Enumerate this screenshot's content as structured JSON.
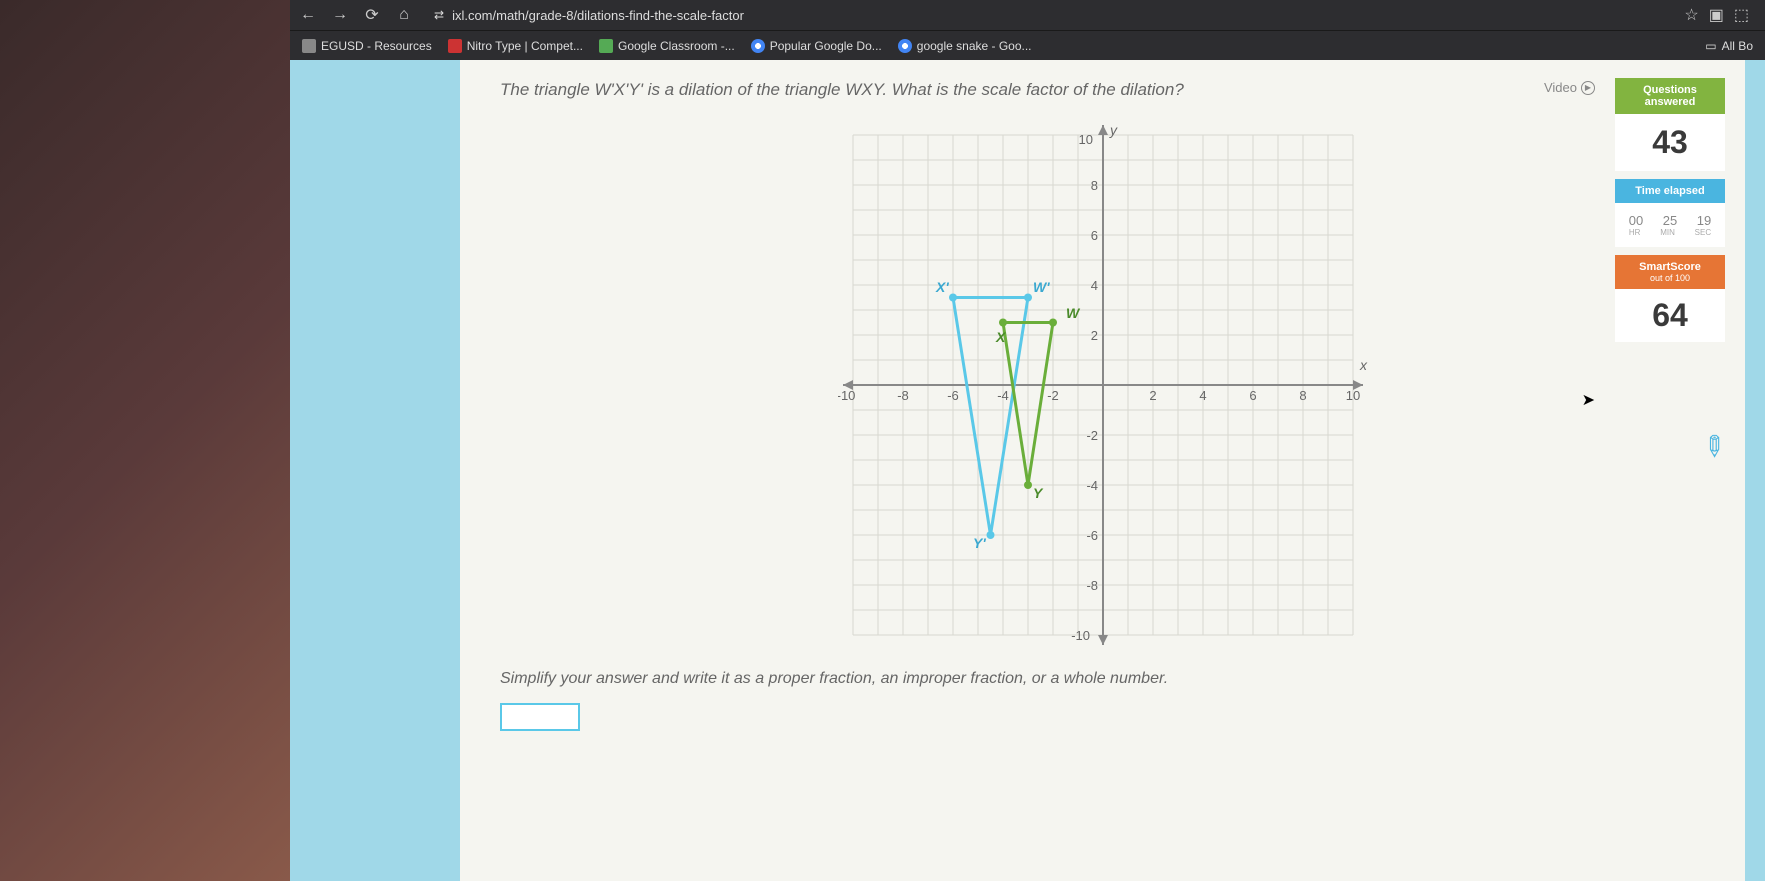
{
  "browser": {
    "url": "ixl.com/math/grade-8/dilations-find-the-scale-factor",
    "bookmarks": [
      "EGUSD - Resources",
      "Nitro Type | Compet...",
      "Google Classroom -...",
      "Popular Google Do...",
      "google snake - Goo..."
    ],
    "all_bookmarks": "All Bo"
  },
  "page": {
    "video_label": "Video",
    "question": "The triangle W'X'Y' is a dilation of the triangle WXY. What is the scale factor of the dilation?",
    "instruction": "Simplify your answer and write it as a proper fraction, an improper fraction, or a whole number.",
    "answer_value": ""
  },
  "stats": {
    "questions_header": "Questions answered",
    "questions_value": "43",
    "time_header": "Time elapsed",
    "time_hr": "00",
    "time_min": "25",
    "time_sec": "19",
    "time_hr_label": "HR",
    "time_min_label": "MIN",
    "time_sec_label": "SEC",
    "smartscore_header": "SmartScore",
    "smartscore_sub": "out of 100",
    "smartscore_value": "64"
  },
  "chart_data": {
    "type": "scatter",
    "title": "",
    "xlabel": "x",
    "ylabel": "y",
    "xlim": [
      -10,
      10
    ],
    "ylim": [
      -10,
      10
    ],
    "x_ticks": [
      -10,
      -8,
      -6,
      -4,
      -2,
      2,
      4,
      6,
      8,
      10
    ],
    "y_ticks": [
      -10,
      -8,
      -6,
      -4,
      -2,
      2,
      4,
      6,
      8,
      10
    ],
    "series": [
      {
        "name": "WXY",
        "color": "#6aae3a",
        "points": [
          {
            "label": "W",
            "x": -2,
            "y": 2.5
          },
          {
            "label": "X",
            "x": -4,
            "y": 2.5
          },
          {
            "label": "Y",
            "x": -3,
            "y": -4
          }
        ]
      },
      {
        "name": "W'X'Y'",
        "color": "#5ac8e8",
        "points": [
          {
            "label": "W'",
            "x": -3,
            "y": 3.5
          },
          {
            "label": "X'",
            "x": -6,
            "y": 3.5
          },
          {
            "label": "Y'",
            "x": -4.5,
            "y": -6
          }
        ]
      }
    ]
  }
}
